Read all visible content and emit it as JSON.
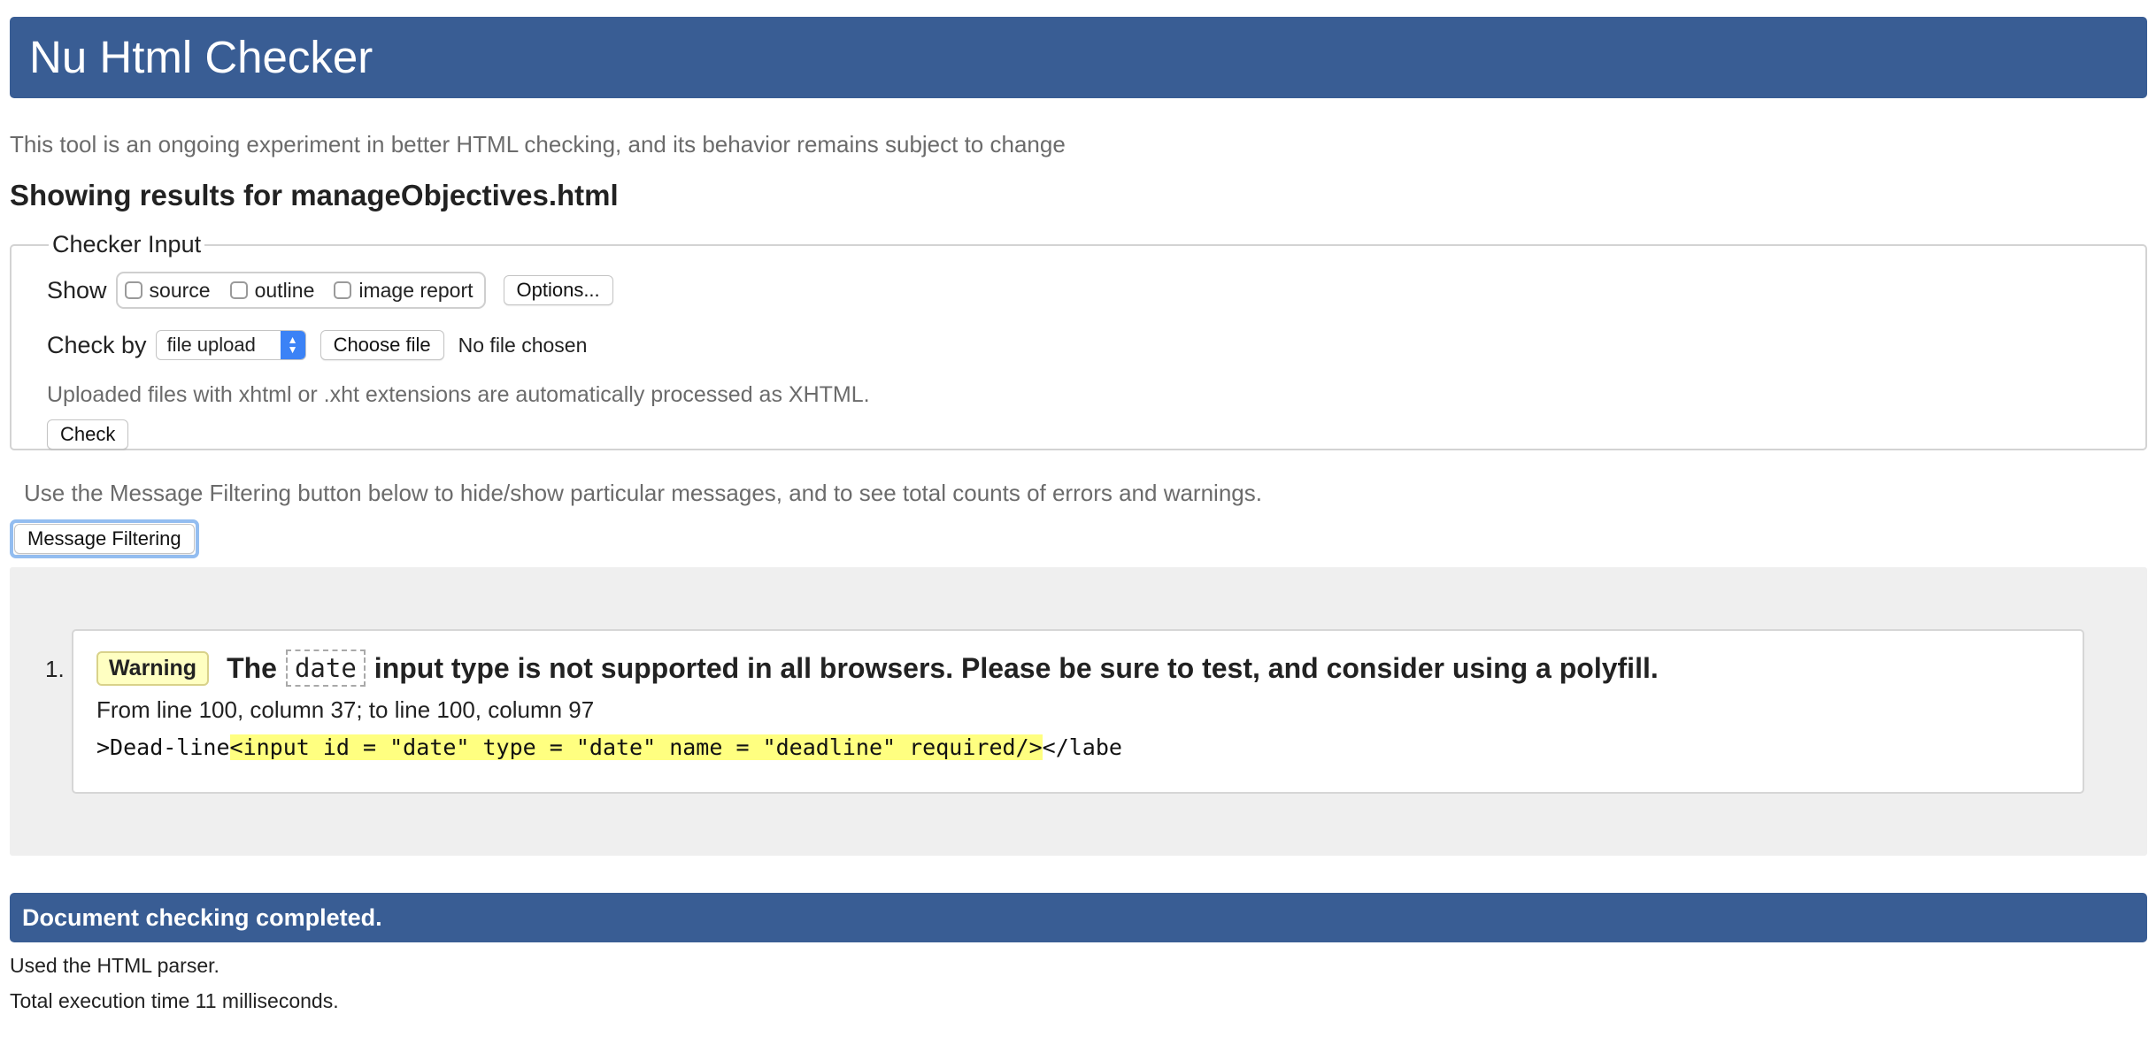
{
  "header": {
    "title": "Nu Html Checker"
  },
  "intro": "This tool is an ongoing experiment in better HTML checking, and its behavior remains subject to change",
  "results_title": "Showing results for manageObjectives.html",
  "checker_input": {
    "legend": "Checker Input",
    "show_label": "Show",
    "show_options": [
      {
        "label": "source",
        "checked": false
      },
      {
        "label": "outline",
        "checked": false
      },
      {
        "label": "image report",
        "checked": false
      }
    ],
    "options_button": "Options...",
    "checkby_label": "Check by",
    "checkby_selected": "file upload",
    "choose_file_button": "Choose file",
    "no_file_text": "No file chosen",
    "upload_note": "Uploaded files with xhtml or .xht extensions are automatically processed as XHTML.",
    "check_button": "Check"
  },
  "filter": {
    "note": "Use the Message Filtering button below to hide/show particular messages, and to see total counts of errors and warnings.",
    "button": "Message Filtering"
  },
  "messages": [
    {
      "number": "1.",
      "type": "Warning",
      "text_before": "The",
      "code": "date",
      "text_after": "input type is not supported in all browsers. Please be sure to test, and consider using a polyfill.",
      "location": "From line 100, column 37; to line 100, column 97",
      "extract_before": ">Dead-line",
      "extract_highlight": "<input id = \"date\" type = \"date\" name = \"deadline\" required/>",
      "extract_after": "</labe"
    }
  ],
  "footer": {
    "status": "Document checking completed.",
    "parser": "Used the HTML parser.",
    "time": "Total execution time 11 milliseconds."
  },
  "colors": {
    "header_bg": "#395d94",
    "warning_badge_bg": "#ffffc2",
    "highlight": "#ffff80",
    "select_accent": "#3b82f6",
    "focus_ring": "#93bdf0"
  },
  "icons": {
    "select_arrows": "chevron-up-down-icon"
  }
}
